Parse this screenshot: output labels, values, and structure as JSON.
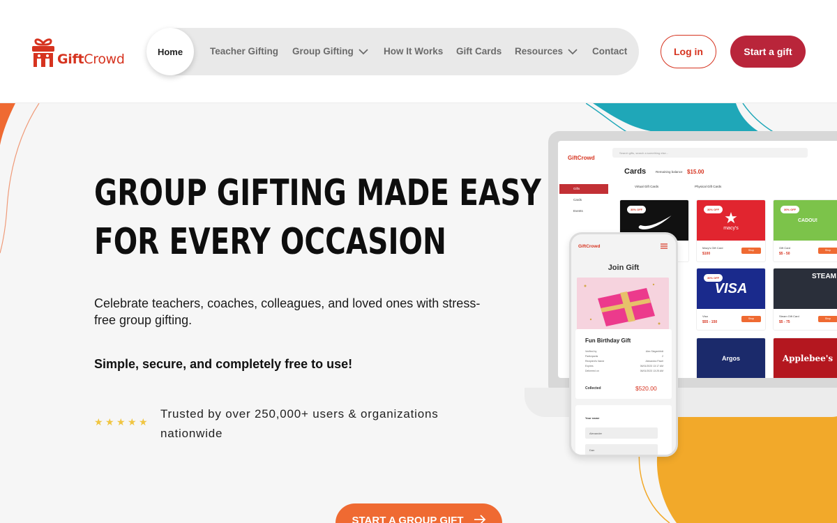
{
  "brand": {
    "name_part1": "Gift",
    "name_part2": "Crowd",
    "primary_color": "#d6331f",
    "accent_color": "#b9253a",
    "cta_color": "#ef6a32"
  },
  "nav": {
    "home": "Home",
    "items": [
      {
        "label": "Teacher Gifting",
        "has_dropdown": false
      },
      {
        "label": "Group Gifting",
        "has_dropdown": true
      },
      {
        "label": "How It Works",
        "has_dropdown": false
      },
      {
        "label": "Gift Cards",
        "has_dropdown": false
      },
      {
        "label": "Resources",
        "has_dropdown": true
      },
      {
        "label": "Contact",
        "has_dropdown": false
      }
    ],
    "login": "Log in",
    "start": "Start a gift"
  },
  "hero": {
    "title_line1": "GROUP GIFTING MADE EASY",
    "title_line2": "FOR EVERY OCCASION",
    "subtitle": "Celebrate teachers, coaches, colleagues, and loved ones with stress-free group gifting.",
    "bold_line": "Simple, secure, and completely free to use!",
    "rating_stars": 5,
    "trusted": "Trusted by over 250,000+ users & organizations nationwide",
    "cta": "START A GROUP GIFT"
  },
  "laptop_screen": {
    "logo": "GiftCrowd",
    "search_placeholder": "Search gifts, search a something else...",
    "title": "Cards",
    "balance_label": "Remaining balance",
    "balance": "$15.00",
    "tab1": "Virtual Gift Cards",
    "tab2": "Physical Gift Cards",
    "sidebar": [
      "Gifts",
      "Cards",
      "Events"
    ],
    "cards": [
      {
        "brand": "Nike",
        "badge": "30% OFF",
        "name": "",
        "price": "",
        "button": "Shop"
      },
      {
        "brand": "macy's",
        "badge": "30% OFF",
        "name": "Macy's Gift Card",
        "price": "$100",
        "button": "Shop"
      },
      {
        "brand": "CADOU!",
        "badge": "30% OFF",
        "name": "Gift Card",
        "price": "$5 - 50",
        "button": "Shop"
      },
      {
        "brand": "VISA",
        "badge": "30% OFF",
        "name": "Visa",
        "price": "$55 - 150",
        "button": "Shop"
      },
      {
        "brand": "STEAM",
        "badge": "",
        "name": "Steam Gift Card",
        "price": "$5 - 75",
        "button": "Shop"
      },
      {
        "brand": "Argos",
        "badge": "",
        "name": "",
        "price": "",
        "button": ""
      },
      {
        "brand": "Applebee's",
        "badge": "",
        "name": "",
        "price": "",
        "button": ""
      }
    ]
  },
  "phone_screen": {
    "logo": "GiftCrowd",
    "title": "Join Gift",
    "gift_title": "Fun Birthday Gift",
    "rows": [
      {
        "label": "Verified by",
        "value": "Alex Siegenfeldt"
      },
      {
        "label": "Participants",
        "value": "2"
      },
      {
        "label": "Recipient's Name",
        "value": "Alexandra Pavel"
      },
      {
        "label": "Expires",
        "value": "06/01/2023 13:17 AM"
      },
      {
        "label": "Delivered on",
        "value": "06/01/2023 13:25 AM"
      }
    ],
    "collected_label": "Collected",
    "collected_amount": "$520.00",
    "form_label": "Your name",
    "inputs": [
      "Alexander",
      "Dan"
    ]
  }
}
